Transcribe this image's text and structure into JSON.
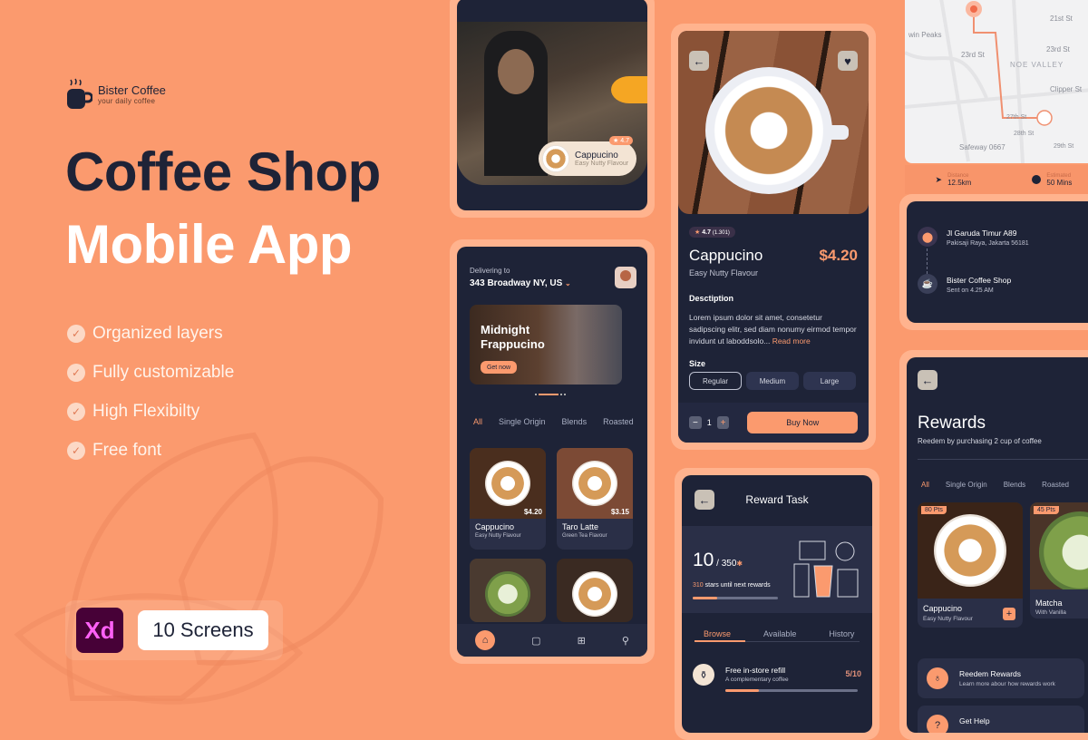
{
  "brand": {
    "name": "Bister Coffee",
    "tagline": "your daily coffee"
  },
  "hero": {
    "line1": "Coffee Shop",
    "line2": "Mobile App"
  },
  "features": [
    "Organized layers",
    "Fully customizable",
    "High Flexibilty",
    "Free font"
  ],
  "badges": {
    "tool": "Xd",
    "screens": "10 Screens"
  },
  "colors": {
    "background": "#fb9a6e",
    "dark": "#1e2337",
    "accent": "#fb9a6e",
    "frame": "#ffb38e"
  },
  "screen1": {
    "chip_title": "Cappucino",
    "chip_subtitle": "Easy Nutty Flavour",
    "rating": "4.7"
  },
  "home": {
    "delivering_label": "Delivering to",
    "address": "343 Broadway NY, US",
    "promo_title_1": "Midnight",
    "promo_title_2": "Frappucino",
    "promo_button": "Get now",
    "tabs": [
      "All",
      "Single Origin",
      "Blends",
      "Roasted"
    ],
    "products": [
      {
        "name": "Cappucino",
        "flavour": "Easy Nutty Flavour",
        "price": "$4.20"
      },
      {
        "name": "Taro Latte",
        "flavour": "Green Tea Flavour",
        "price": "$3.15"
      }
    ],
    "nav": [
      "home-icon",
      "bag-icon",
      "gift-icon",
      "profile-icon"
    ]
  },
  "detail": {
    "rating": "4.7",
    "reviews": "(1.301)",
    "name": "Cappucino",
    "price": "$4.20",
    "flavour": "Easy Nutty Flavour",
    "description_label": "Desctiption",
    "description": "Lorem ipsum dolor sit amet, consetetur sadipscing elitr, sed diam nonumy eirmod tempor invidunt ut laboddsolo...",
    "read_more": "Read more",
    "size_label": "Size",
    "sizes": [
      "Regular",
      "Medium",
      "Large"
    ],
    "selected_size": "Regular",
    "quantity": "1",
    "buy_button": "Buy Now"
  },
  "reward_task": {
    "title": "Reward Task",
    "stars": "10",
    "total": "/ 350",
    "remaining_count": "310",
    "remaining_text": "stars until next rewards",
    "progress": 0.29,
    "tabs": [
      "Browse",
      "Available",
      "History"
    ],
    "task": {
      "title": "Free in-store refill",
      "subtitle": "A complementary coffee",
      "progress_text": "5/10",
      "progress": 0.25
    }
  },
  "map": {
    "labels": [
      "21st St",
      "23rd St",
      "23rd St",
      "NOE VALLEY",
      "Clipper St",
      "27th St",
      "28th St",
      "29th St",
      "Safeway 0667",
      "win Peaks"
    ],
    "distance_label": "Distance",
    "distance": "12.5km",
    "estimated_label": "Estimated",
    "estimated": "50 Mins"
  },
  "tracking": {
    "from_title": "Jl Garuda Timur A89",
    "from_sub": "Pakisaji Raya, Jakarta 56181",
    "to_title": "Bister Coffee Shop",
    "to_sub": "Sent on 4.25 AM"
  },
  "rewards": {
    "title": "Rewards",
    "subtitle": "Reedem by purchasing 2 cup of coffee",
    "tabs": [
      "All",
      "Single Origin",
      "Blends",
      "Roasted"
    ],
    "items": [
      {
        "pts": "80 Pts",
        "name": "Cappucino",
        "flavour": "Easy Nutty Flavour"
      },
      {
        "pts": "45 Pts",
        "name": "Matcha",
        "flavour": "With Vanilla"
      }
    ],
    "links": [
      {
        "title": "Reedem Rewards",
        "subtitle": "Learn more abour how rewards work"
      },
      {
        "title": "Get Help",
        "subtitle": ""
      }
    ]
  }
}
